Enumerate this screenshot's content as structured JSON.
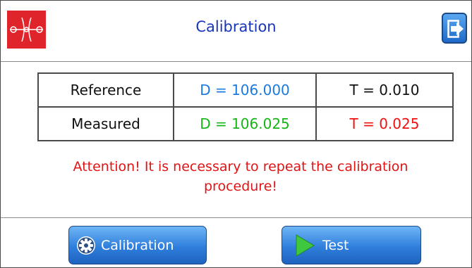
{
  "header": {
    "title": "Calibration"
  },
  "table": {
    "rows": [
      {
        "label": "Reference",
        "d_value": "D = 106.000",
        "t_value": "T = 0.010"
      },
      {
        "label": "Measured",
        "d_value": "D = 106.025",
        "t_value": "T = 0.025"
      }
    ]
  },
  "message": {
    "line1": "Attention! It is necessary to repeat the calibration",
    "line2": "procedure!"
  },
  "footer": {
    "calibration_label": "Calibration",
    "test_label": "Test"
  },
  "icons": {
    "logo": "pipe-gauge-logo-icon",
    "exit": "exit-icon",
    "calibration": "gear-icon",
    "test": "play-icon"
  },
  "colors": {
    "title": "#1a36b8",
    "reference_d": "#1a7ae0",
    "measured_d": "#16b516",
    "measured_t": "#ee1111",
    "attention": "#e01414",
    "logo_bg": "#e0242c",
    "button": "#2f7fdc"
  }
}
